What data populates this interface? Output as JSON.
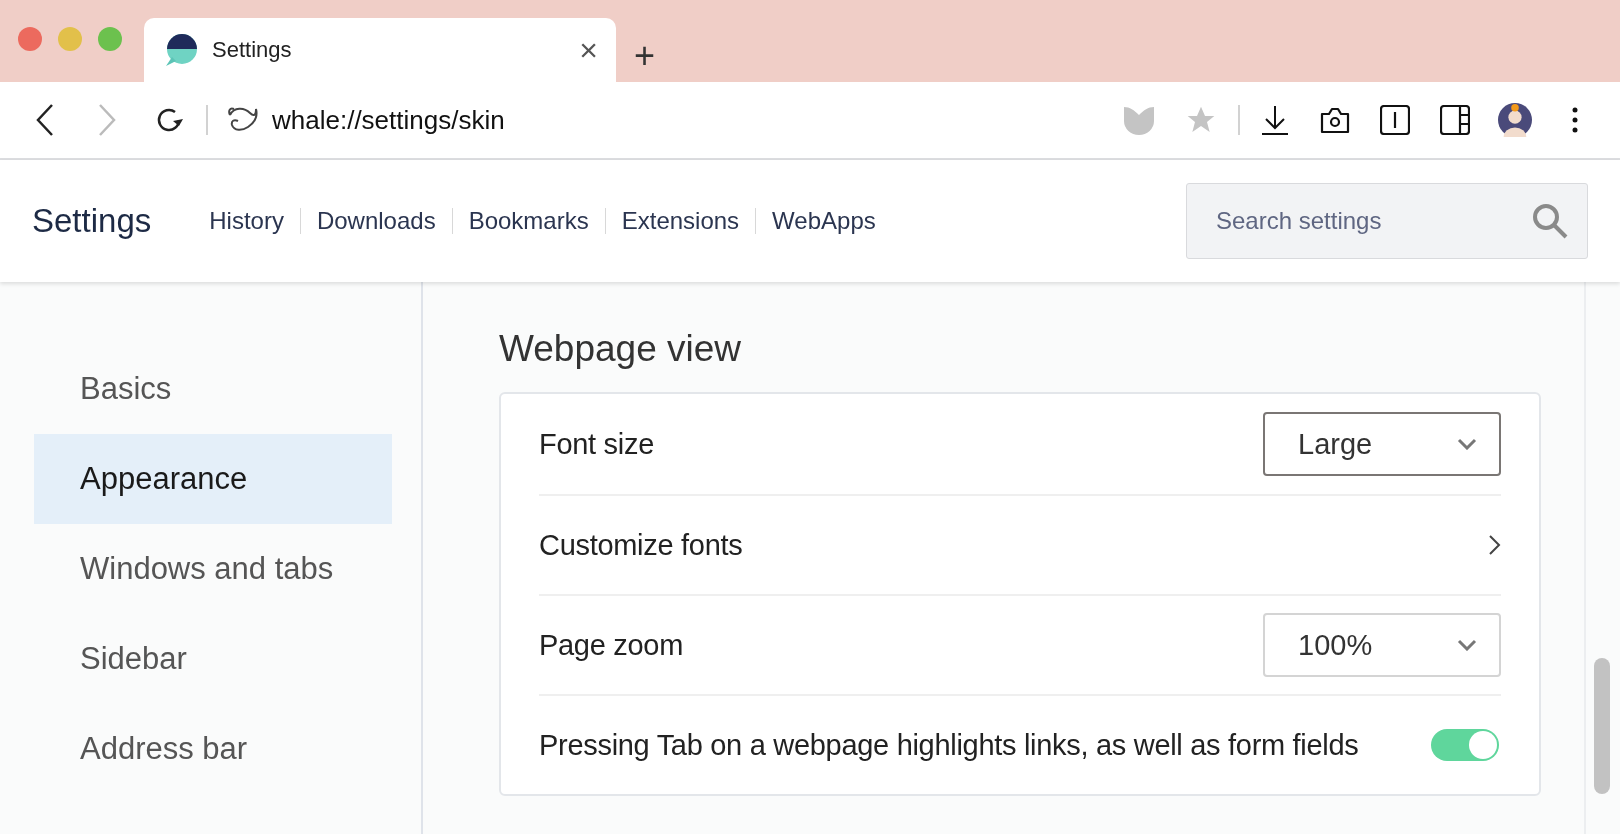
{
  "tab": {
    "title": "Settings",
    "close": "×",
    "new_tab": "+"
  },
  "address_bar": {
    "url": "whale://settings/skin"
  },
  "header": {
    "title": "Settings",
    "links": [
      "History",
      "Downloads",
      "Bookmarks",
      "Extensions",
      "WebApps"
    ],
    "search": {
      "placeholder": "Search settings"
    }
  },
  "sidebar": {
    "items": [
      {
        "label": "Basics",
        "selected": false
      },
      {
        "label": "Appearance",
        "selected": true
      },
      {
        "label": "Windows and tabs",
        "selected": false
      },
      {
        "label": "Sidebar",
        "selected": false
      },
      {
        "label": "Address bar",
        "selected": false
      }
    ]
  },
  "section": {
    "title": "Webpage view",
    "rows": [
      {
        "kind": "select",
        "label": "Font size",
        "value": "Large",
        "focused": true
      },
      {
        "kind": "link",
        "label": "Customize fonts"
      },
      {
        "kind": "select",
        "label": "Page zoom",
        "value": "100%",
        "focused": false
      },
      {
        "kind": "toggle",
        "label": "Pressing Tab on a webpage highlights links, as well as form fields",
        "on": true
      }
    ]
  }
}
